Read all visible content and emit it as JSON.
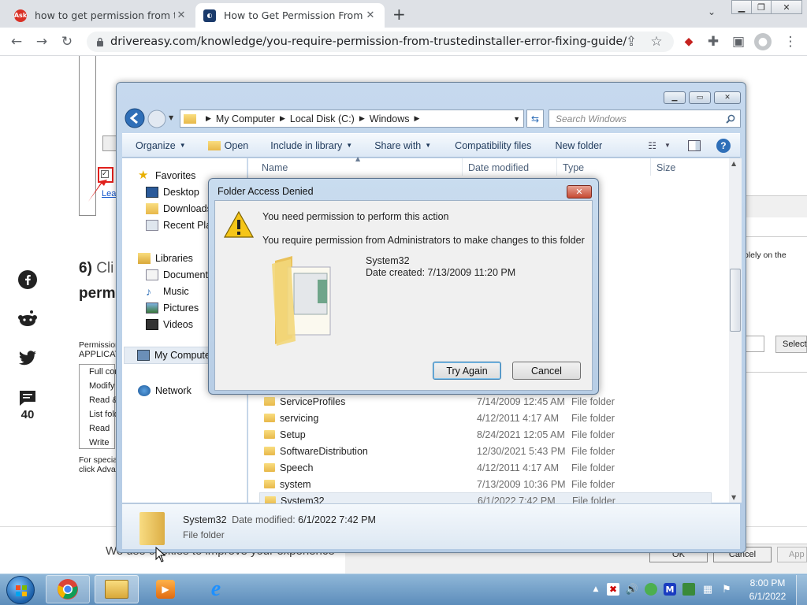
{
  "browser": {
    "tabs": [
      {
        "title": "how to get permission from trust",
        "active": false,
        "favicon_color": "#d93025"
      },
      {
        "title": "How to Get Permission From Trus",
        "active": true,
        "favicon_color": "#1a3a6b"
      }
    ],
    "url": "drivereasy.com/knowledge/you-require-permission-from-trustedinstaller-error-fixing-guide/"
  },
  "page": {
    "step_number": "6)",
    "step_text": "Cli",
    "step_bold_next": "perm",
    "comment_count": "40",
    "link_fragment": "Lea",
    "perm_header_1": "Permission",
    "perm_header_2": "APPLICAT",
    "perm_items": [
      "Full con",
      "Modify",
      "Read &",
      "List fold",
      "Read",
      "Write"
    ],
    "special_1": "For specia",
    "special_2": "click Adva",
    "right_text": "olely on the",
    "select_btn": "Select",
    "ok_btn": "OK",
    "cancel_btn": "Cancel",
    "apply_btn": "App",
    "cookie_text": "We use cookies to improve your experience"
  },
  "explorer": {
    "breadcrumb": [
      "My Computer",
      "Local Disk (C:)",
      "Windows"
    ],
    "search_placeholder": "Search Windows",
    "toolbar": {
      "organize": "Organize",
      "open": "Open",
      "include": "Include in library",
      "share": "Share with",
      "compat": "Compatibility files",
      "new_folder": "New folder"
    },
    "nav": {
      "favorites": "Favorites",
      "desktop": "Desktop",
      "downloads": "Downloads",
      "recent": "Recent Plac",
      "libraries": "Libraries",
      "documents": "Documents",
      "music": "Music",
      "pictures": "Pictures",
      "videos": "Videos",
      "computer": "My Compute",
      "network": "Network"
    },
    "columns": {
      "name": "Name",
      "date": "Date modified",
      "type": "Type",
      "size": "Size"
    },
    "files": [
      {
        "name": "ServiceProfiles",
        "date": "7/14/2009 12:45 AM",
        "type": "File folder"
      },
      {
        "name": "servicing",
        "date": "4/12/2011 4:17 AM",
        "type": "File folder"
      },
      {
        "name": "Setup",
        "date": "8/24/2021 12:05 AM",
        "type": "File folder"
      },
      {
        "name": "SoftwareDistribution",
        "date": "12/30/2021 5:43 PM",
        "type": "File folder"
      },
      {
        "name": "Speech",
        "date": "4/12/2011 4:17 AM",
        "type": "File folder"
      },
      {
        "name": "system",
        "date": "7/13/2009 10:36 PM",
        "type": "File folder"
      },
      {
        "name": "System32",
        "date": "6/1/2022 7:42 PM",
        "type": "File folder"
      }
    ],
    "status": {
      "name": "System32",
      "date_label": "Date modified:",
      "date_value": "6/1/2022 7:42 PM",
      "type": "File folder"
    }
  },
  "dialog": {
    "title": "Folder Access Denied",
    "heading": "You need permission to perform this action",
    "message": "You require permission from Administrators to make changes to this folder",
    "folder_name": "System32",
    "date_created": "Date created: 7/13/2009 11:20 PM",
    "try_again": "Try Again",
    "cancel": "Cancel"
  },
  "taskbar": {
    "time": "8:00 PM",
    "date": "6/1/2022"
  }
}
